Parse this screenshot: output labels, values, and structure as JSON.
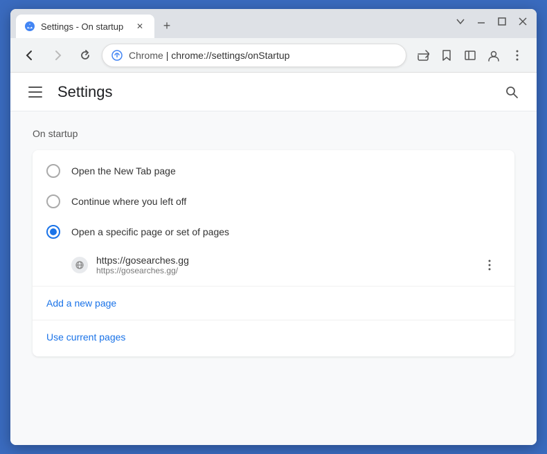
{
  "window": {
    "title": "Settings - On startup",
    "tab_title": "Settings - On startup",
    "url_source": "Chrome",
    "url_path": "chrome://settings/onStartup"
  },
  "nav": {
    "back_label": "←",
    "forward_label": "→",
    "reload_label": "↻"
  },
  "settings": {
    "menu_label": "Menu",
    "title": "Settings",
    "search_label": "Search settings"
  },
  "on_startup": {
    "section_title": "On startup",
    "options": [
      {
        "id": "new-tab",
        "label": "Open the New Tab page",
        "selected": false
      },
      {
        "id": "continue",
        "label": "Continue where you left off",
        "selected": false
      },
      {
        "id": "specific",
        "label": "Open a specific page or set of pages",
        "selected": true
      }
    ],
    "page_entry": {
      "name": "https://gosearches.gg",
      "url": "https://gosearches.gg/"
    },
    "add_page_label": "Add a new page",
    "use_current_label": "Use current pages"
  },
  "window_controls": {
    "minimize": "—",
    "maximize": "□",
    "close": "✕"
  }
}
